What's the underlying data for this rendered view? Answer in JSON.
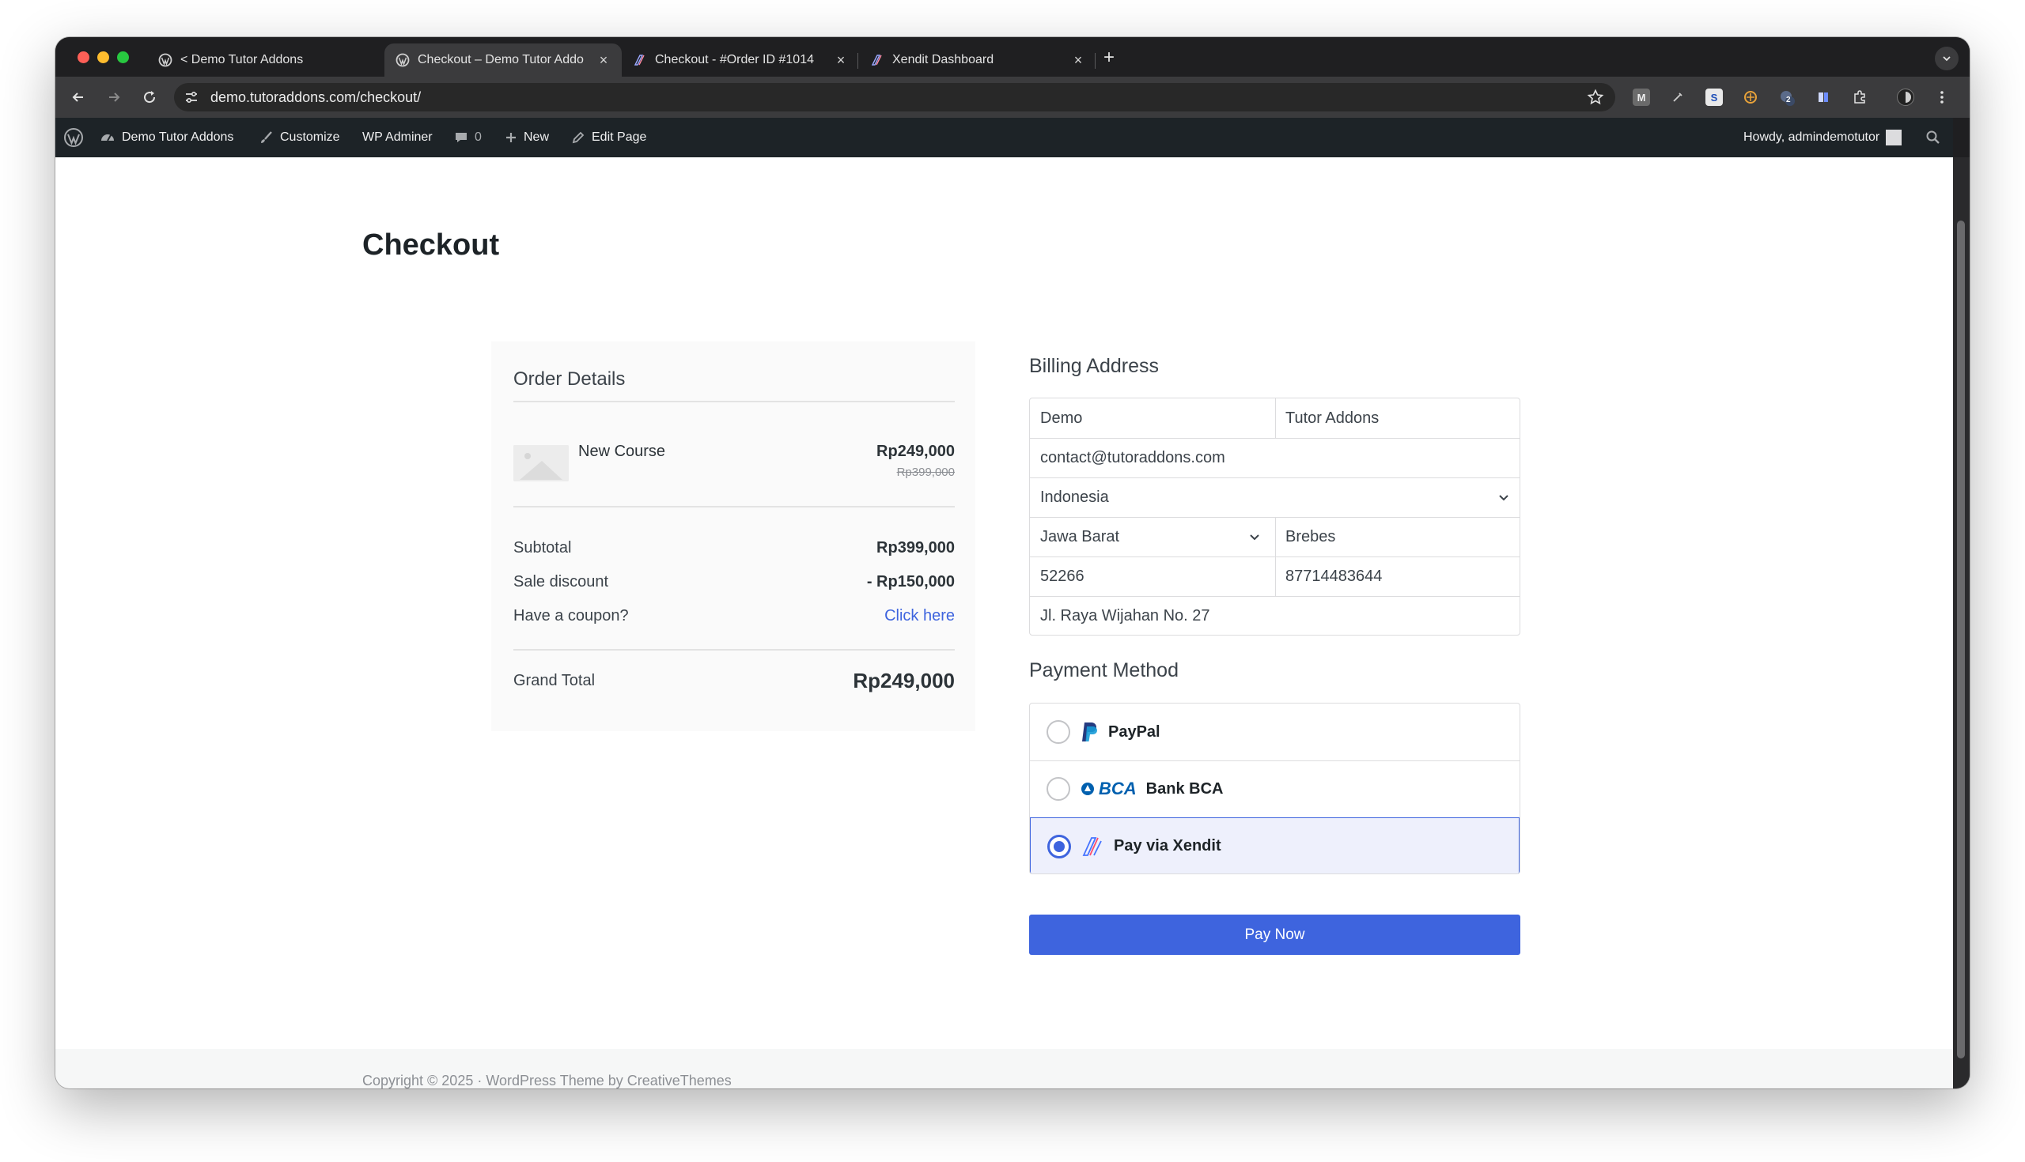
{
  "browser": {
    "tabs": [
      {
        "title": "< Demo Tutor Addons",
        "active": false,
        "icon": "wordpress-icon"
      },
      {
        "title": "Checkout – Demo Tutor Addo",
        "active": true,
        "icon": "wordpress-icon"
      },
      {
        "title": "Checkout - #Order ID #1014",
        "active": false,
        "icon": "xendit-icon"
      },
      {
        "title": "Xendit Dashboard",
        "active": false,
        "icon": "xendit-icon"
      }
    ],
    "url": "demo.tutoraddons.com/checkout/",
    "ext_badge": "2"
  },
  "adminbar": {
    "site_name": "Demo Tutor Addons",
    "customize": "Customize",
    "wp_adminer": "WP Adminer",
    "comments_count": "0",
    "new": "New",
    "edit_page": "Edit Page",
    "howdy": "Howdy, admindemotutor"
  },
  "page": {
    "title": "Checkout"
  },
  "order": {
    "heading": "Order Details",
    "item": {
      "name": "New Course",
      "price": "Rp249,000",
      "original_price": "Rp399,000"
    },
    "subtotal_label": "Subtotal",
    "subtotal_value": "Rp399,000",
    "discount_label": "Sale discount",
    "discount_value": "- Rp150,000",
    "coupon_label": "Have a coupon?",
    "coupon_link": "Click here",
    "grand_total_label": "Grand Total",
    "grand_total_value": "Rp249,000"
  },
  "billing": {
    "heading": "Billing Address",
    "first_name": "Demo",
    "last_name": "Tutor Addons",
    "email": "contact@tutoraddons.com",
    "country": "Indonesia",
    "state": "Jawa Barat",
    "city": "Brebes",
    "postcode": "52266",
    "phone": "87714483644",
    "address": "Jl. Raya Wijahan No. 27"
  },
  "payment": {
    "heading": "Payment Method",
    "options": [
      {
        "label": "PayPal",
        "selected": false,
        "icon": "paypal-icon"
      },
      {
        "label": "Bank BCA",
        "selected": false,
        "icon": "bca-logo-icon",
        "logo_text": "BCA"
      },
      {
        "label": "Pay via Xendit",
        "selected": true,
        "icon": "xendit-icon"
      }
    ],
    "pay_button": "Pay Now"
  },
  "footer": {
    "text": "Copyright © 2025 · WordPress Theme by CreativeThemes"
  },
  "colors": {
    "accent": "#3e64de",
    "adminbar": "#1d2327",
    "selected_bg": "#eef0fc"
  }
}
